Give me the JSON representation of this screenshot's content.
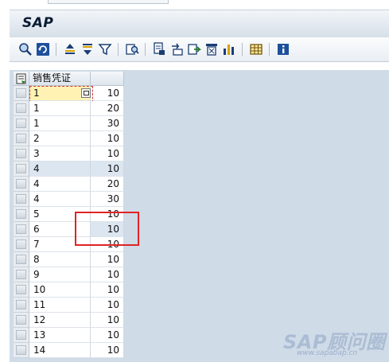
{
  "app": {
    "title": "SAP"
  },
  "toolbar": {
    "buttons": [
      {
        "name": "detail-icon"
      },
      {
        "name": "refresh-icon"
      },
      {
        "name": "sort-ascending-icon"
      },
      {
        "name": "sort-descending-icon"
      },
      {
        "name": "filter-icon"
      },
      {
        "name": "find-icon"
      },
      {
        "name": "print-preview-icon"
      },
      {
        "name": "export-icon"
      },
      {
        "name": "send-icon"
      },
      {
        "name": "column-select-icon"
      },
      {
        "name": "graphic-icon"
      },
      {
        "name": "layout-icon"
      },
      {
        "name": "info-icon"
      }
    ]
  },
  "grid": {
    "column_header": "销售凭证",
    "rows": [
      {
        "doc": "1",
        "item": "10"
      },
      {
        "doc": "1",
        "item": "20"
      },
      {
        "doc": "1",
        "item": "30"
      },
      {
        "doc": "2",
        "item": "10"
      },
      {
        "doc": "3",
        "item": "10"
      },
      {
        "doc": "4",
        "item": "10"
      },
      {
        "doc": "4",
        "item": "20"
      },
      {
        "doc": "4",
        "item": "30"
      },
      {
        "doc": "5",
        "item": "10"
      },
      {
        "doc": "6",
        "item": "10"
      },
      {
        "doc": "7",
        "item": "10"
      },
      {
        "doc": "8",
        "item": "10"
      },
      {
        "doc": "9",
        "item": "10"
      },
      {
        "doc": "10",
        "item": "10"
      },
      {
        "doc": "11",
        "item": "10"
      },
      {
        "doc": "12",
        "item": "10"
      },
      {
        "doc": "13",
        "item": "10"
      },
      {
        "doc": "14",
        "item": "10"
      }
    ]
  },
  "watermark": {
    "text": "SAP顾问圈",
    "url": "www.sapabap.cn"
  }
}
